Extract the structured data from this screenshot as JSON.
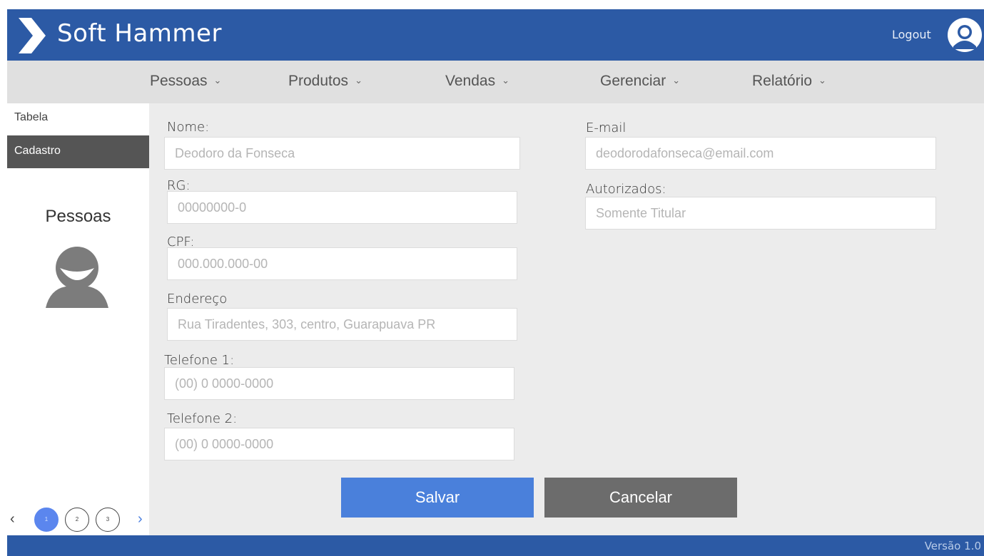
{
  "header": {
    "app_title": "Soft Hammer",
    "logout_label": "Logout"
  },
  "nav": {
    "items": [
      {
        "label": "Pessoas"
      },
      {
        "label": "Produtos"
      },
      {
        "label": "Vendas"
      },
      {
        "label": "Gerenciar"
      },
      {
        "label": "Relatório"
      }
    ],
    "chevron": "⌄"
  },
  "sidebar": {
    "links": [
      {
        "label": "Tabela",
        "active": false
      },
      {
        "label": "Cadastro",
        "active": true
      }
    ],
    "section_title": "Pessoas",
    "section_icon": "person-icon"
  },
  "pagination": {
    "prev": "‹",
    "next": "›",
    "pages": [
      "1",
      "2",
      "3"
    ],
    "current_page": "1"
  },
  "form": {
    "nome": {
      "label": "Nome:",
      "placeholder": "Deodoro da Fonseca",
      "value": ""
    },
    "rg": {
      "label": "RG:",
      "placeholder": "00000000-0",
      "value": ""
    },
    "cpf": {
      "label": "CPF:",
      "placeholder": "000.000.000-00",
      "value": ""
    },
    "endereco": {
      "label": "Endereço",
      "placeholder": "Rua Tiradentes, 303, centro, Guarapuava PR",
      "value": ""
    },
    "telefone1": {
      "label": "Telefone 1:",
      "placeholder": "(00) 0 0000-0000",
      "value": ""
    },
    "telefone2": {
      "label": "Telefone 2:",
      "placeholder": "(00) 0 0000-0000",
      "value": ""
    },
    "email": {
      "label": "E-mail",
      "placeholder": "deodorodafonseca@email.com",
      "value": ""
    },
    "autorizados": {
      "label": "Autorizados:",
      "placeholder": "Somente Titular",
      "value": ""
    }
  },
  "actions": {
    "save_label": "Salvar",
    "cancel_label": "Cancelar"
  },
  "footer": {
    "version": "Versão 1.0"
  },
  "colors": {
    "brand_blue": "#2c5aa5",
    "save_button": "#4a80db",
    "cancel_button": "#6c6c6c",
    "active_sidebar": "#555555",
    "page_active": "#5b86ee"
  }
}
